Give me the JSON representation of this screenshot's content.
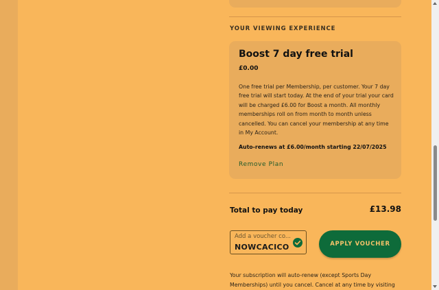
{
  "section": {
    "label": "YOUR VIEWING EXPERIENCE"
  },
  "plan": {
    "title": "Boost 7 day free trial",
    "price": "£0.00",
    "description": "One free trial per Membership, per customer. Your 7 day free trial will start today. At the end of your trial your card will be charged £6.00 for Boost a month. All monthly memberships roll on from month to month unless cancelled. You can cancel your membership at any time in My Account.",
    "renew_note": "Auto-renews at £6.00/month starting 22/07/2025",
    "remove_label": "Remove Plan"
  },
  "total": {
    "label": "Total to pay today",
    "amount": "£13.98"
  },
  "voucher": {
    "placeholder": "Add a voucher co...",
    "value": "NOWCACICO",
    "status_icon": "check-circle-icon",
    "apply_label": "APPLY VOUCHER"
  },
  "footer": {
    "text": "Your subscription will auto-renew (except Sports Day Memberships) until you cancel. Cancel at any time by visiting My"
  },
  "colors": {
    "background": "#f9b65a",
    "card": "#e9ac5c",
    "accent_green": "#0e6b3a",
    "button_text": "#f5c36a"
  }
}
